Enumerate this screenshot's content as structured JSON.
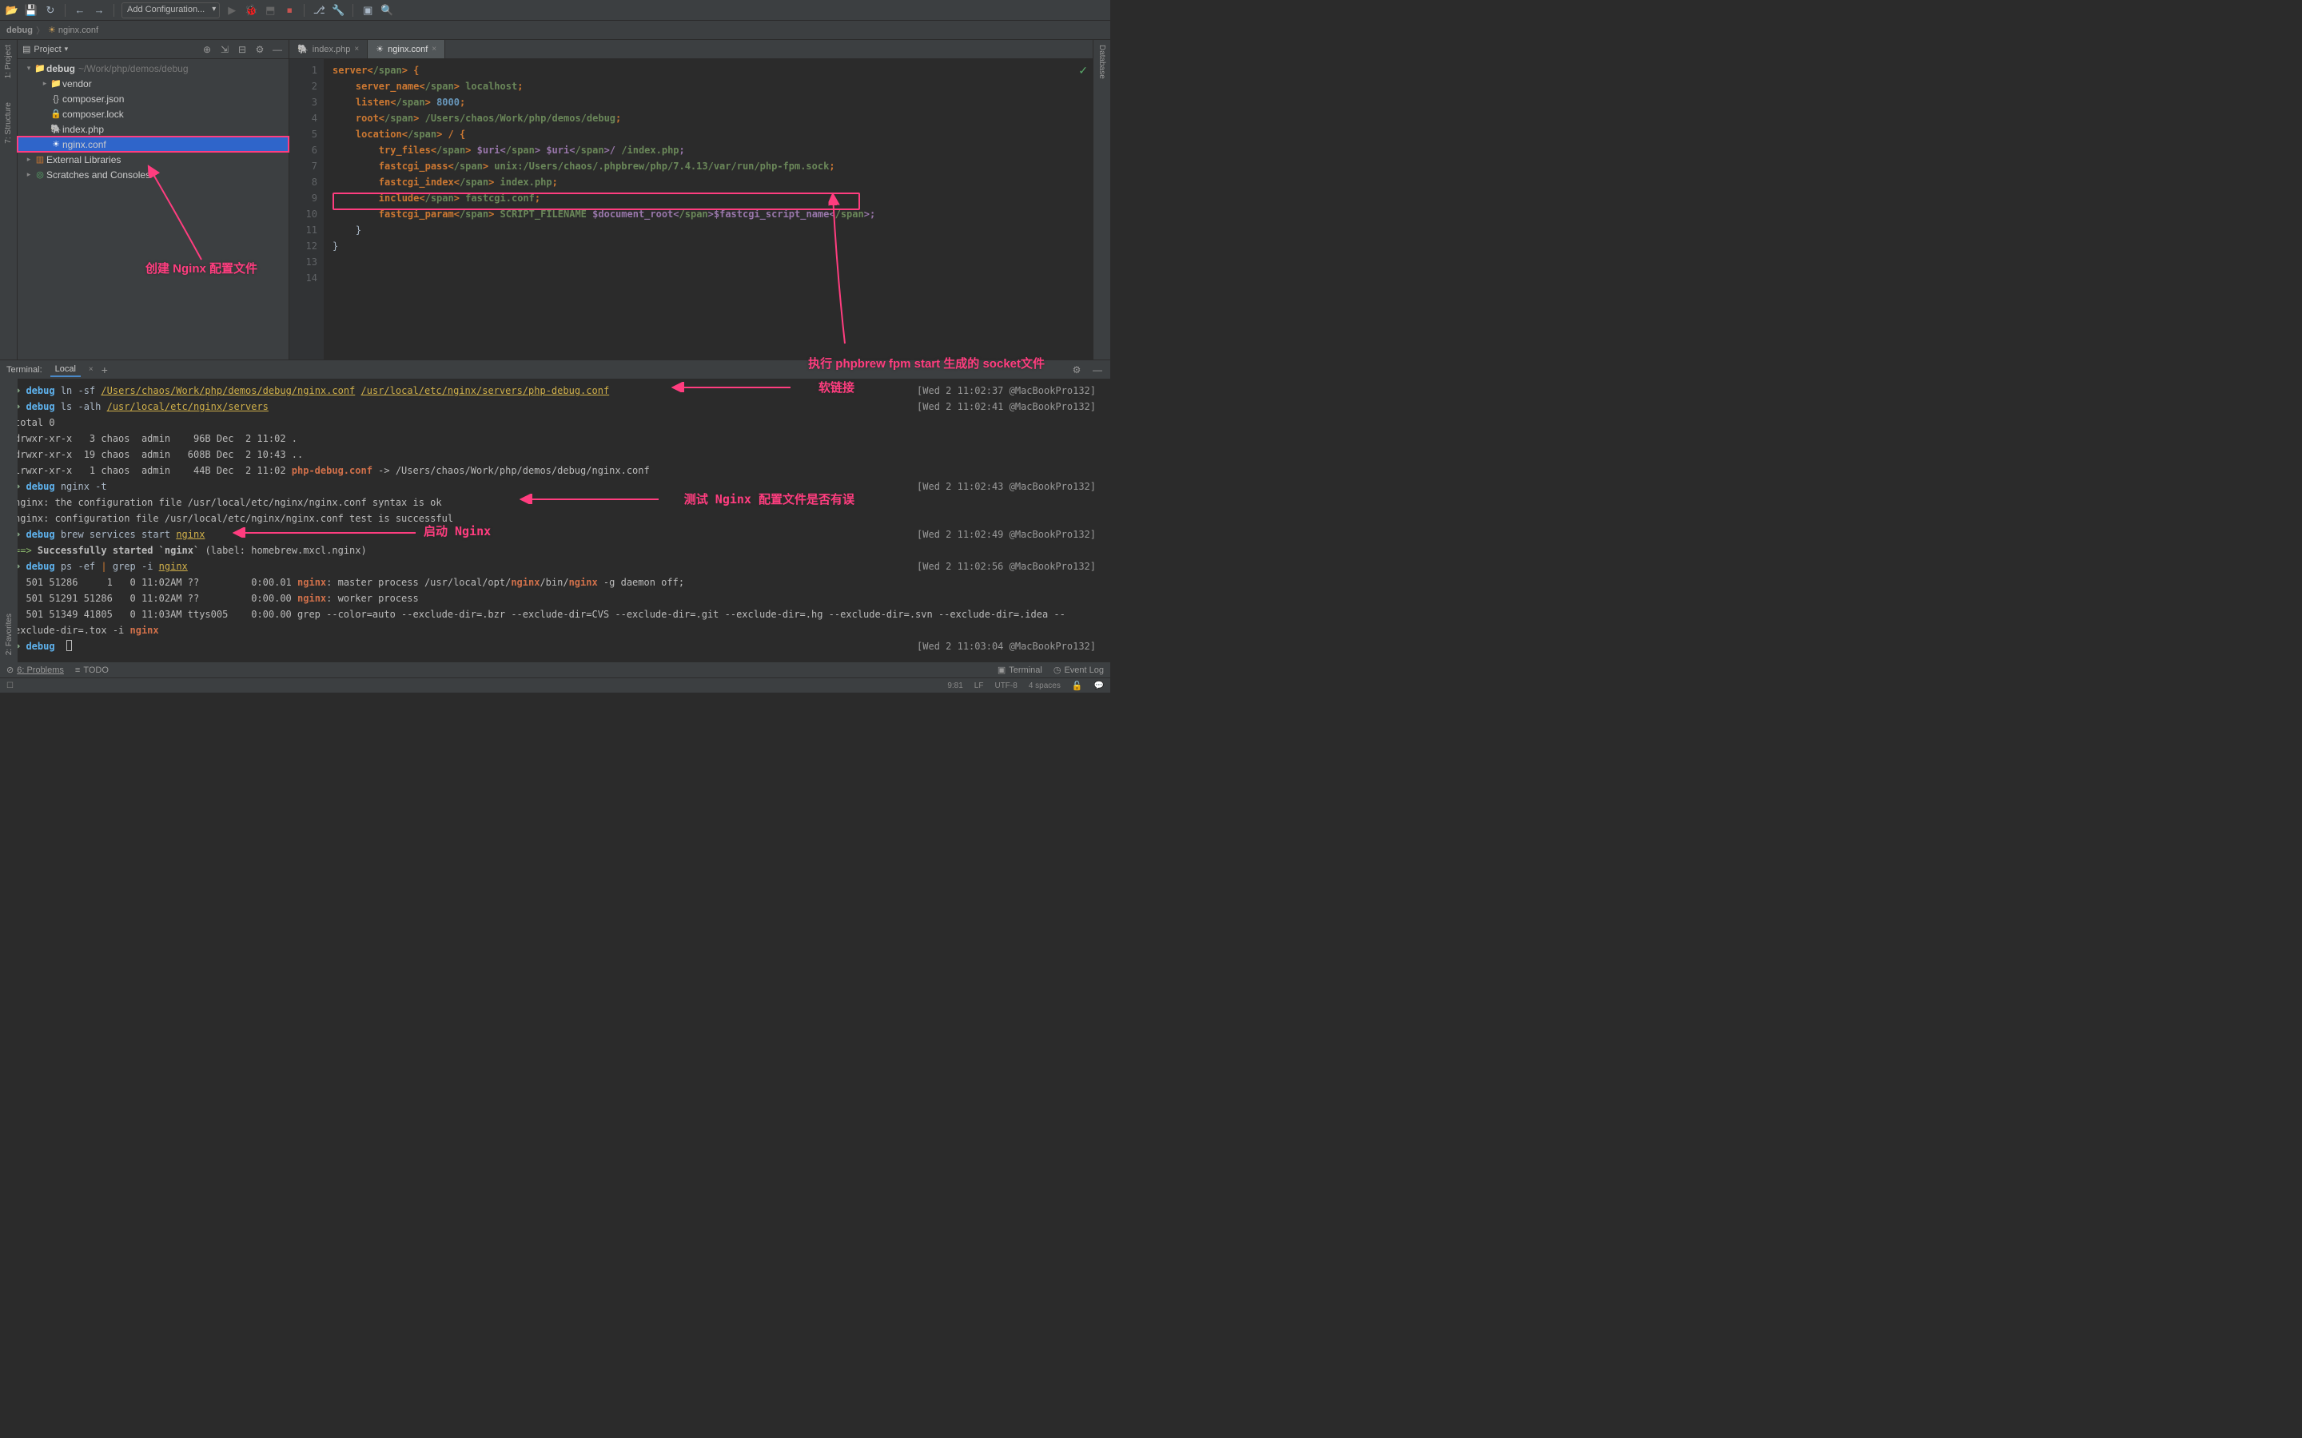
{
  "toolbar": {
    "config_label": "Add Configuration..."
  },
  "breadcrumb": {
    "root": "debug",
    "file": "nginx.conf"
  },
  "rails": {
    "project": "1: Project",
    "structure": "7: Structure",
    "favorites": "2: Favorites",
    "database": "Database"
  },
  "project": {
    "title": "Project",
    "root": "debug",
    "root_path": "~/Work/php/demos/debug",
    "items": [
      {
        "label": "vendor",
        "icon": "folder",
        "indent": 2,
        "arrow": "▸"
      },
      {
        "label": "composer.json",
        "icon": "json",
        "indent": 2
      },
      {
        "label": "composer.lock",
        "icon": "lock",
        "indent": 2
      },
      {
        "label": "index.php",
        "icon": "php",
        "indent": 2
      },
      {
        "label": "nginx.conf",
        "icon": "cog",
        "indent": 2,
        "selected": true
      }
    ],
    "external": "External Libraries",
    "scratches": "Scratches and Consoles"
  },
  "tabs": [
    {
      "label": "index.php",
      "icon": "php"
    },
    {
      "label": "nginx.conf",
      "icon": "cog",
      "active": true
    }
  ],
  "code": {
    "lines": [
      {
        "n": 1,
        "t": "server {",
        "kw": [
          "server"
        ]
      },
      {
        "n": 2,
        "t": "    server_name localhost;"
      },
      {
        "n": 3,
        "t": "    listen 8000;"
      },
      {
        "n": 4,
        "t": ""
      },
      {
        "n": 5,
        "t": "    root /Users/chaos/Work/php/demos/debug;"
      },
      {
        "n": 6,
        "t": ""
      },
      {
        "n": 7,
        "t": "    location / {"
      },
      {
        "n": 8,
        "t": "        try_files $uri $uri/ /index.php;"
      },
      {
        "n": 9,
        "t": "        fastcgi_pass unix:/Users/chaos/.phpbrew/php/7.4.13/var/run/php-fpm.sock;"
      },
      {
        "n": 10,
        "t": "        fastcgi_index index.php;"
      },
      {
        "n": 11,
        "t": "        include fastcgi.conf;"
      },
      {
        "n": 12,
        "t": "        fastcgi_param SCRIPT_FILENAME $document_root$fastcgi_script_name;"
      },
      {
        "n": 13,
        "t": "    }"
      },
      {
        "n": 14,
        "t": "}"
      }
    ]
  },
  "annotations": {
    "create_conf": "创建 Nginx 配置文件",
    "socket": "执行 phpbrew fpm start 生成的 socket文件",
    "symlink": "软链接",
    "test_conf": "测试 Nginx 配置文件是否有误",
    "start_nginx": "启动 Nginx"
  },
  "terminal": {
    "title": "Terminal:",
    "tab": "Local",
    "lines": [
      {
        "type": "cmd",
        "ctx": "debug",
        "cmd": "ln -sf ",
        "paths": [
          "/Users/chaos/Work/php/demos/debug/nginx.conf",
          "/usr/local/etc/nginx/servers/php-debug.conf"
        ],
        "time": "[Wed 2 11:02:37 @MacBookPro132]"
      },
      {
        "type": "cmd",
        "ctx": "debug",
        "cmd": "ls -alh ",
        "paths": [
          "/usr/local/etc/nginx/servers"
        ],
        "time": "[Wed 2 11:02:41 @MacBookPro132]"
      },
      {
        "type": "out",
        "text": "total 0"
      },
      {
        "type": "out",
        "text": "drwxr-xr-x   3 chaos  admin    96B Dec  2 11:02 ."
      },
      {
        "type": "out",
        "text": "drwxr-xr-x  19 chaos  admin   608B Dec  2 10:43 .."
      },
      {
        "type": "out",
        "text": "lrwxr-xr-x   1 chaos  admin    44B Dec  2 11:02 php-debug.conf -> /Users/chaos/Work/php/demos/debug/nginx.conf",
        "hl": "php-debug.conf"
      },
      {
        "type": "cmd",
        "ctx": "debug",
        "cmd": "nginx -t",
        "time": "[Wed 2 11:02:43 @MacBookPro132]"
      },
      {
        "type": "out",
        "text": "nginx: the configuration file /usr/local/etc/nginx/nginx.conf syntax is ok"
      },
      {
        "type": "out",
        "text": "nginx: configuration file /usr/local/etc/nginx/nginx.conf test is successful"
      },
      {
        "type": "cmd",
        "ctx": "debug",
        "cmd": "brew services start ",
        "paths": [
          "nginx"
        ],
        "time": "[Wed 2 11:02:49 @MacBookPro132]"
      },
      {
        "type": "ok",
        "text": "==> Successfully started `nginx` (label: homebrew.mxcl.nginx)"
      },
      {
        "type": "cmd",
        "ctx": "debug",
        "cmd": "ps -ef | grep -i ",
        "paths": [
          "nginx"
        ],
        "pipe": true,
        "time": "[Wed 2 11:02:56 @MacBookPro132]"
      },
      {
        "type": "out",
        "text": "  501 51286     1   0 11:02AM ??         0:00.01 nginx: master process /usr/local/opt/nginx/bin/nginx -g daemon off;",
        "hlwords": [
          "nginx",
          "nginx",
          "nginx"
        ]
      },
      {
        "type": "out",
        "text": "  501 51291 51286   0 11:02AM ??         0:00.00 nginx: worker process",
        "hlwords": [
          "nginx"
        ]
      },
      {
        "type": "out",
        "text": "  501 51349 41805   0 11:03AM ttys005    0:00.00 grep --color=auto --exclude-dir=.bzr --exclude-dir=CVS --exclude-dir=.git --exclude-dir=.hg --exclude-dir=.svn --exclude-dir=.idea --exclude-dir=.tox -i nginx",
        "hlwords": [
          "nginx"
        ],
        "wrap": true
      },
      {
        "type": "cmd",
        "ctx": "debug",
        "cmd": "",
        "cursor": true,
        "time": "[Wed 2 11:03:04 @MacBookPro132]"
      }
    ]
  },
  "bottombar": {
    "problems": "6: Problems",
    "todo": "TODO",
    "terminal": "Terminal",
    "eventlog": "Event Log"
  },
  "status": {
    "pos": "9:81",
    "le": "LF",
    "enc": "UTF-8",
    "indent": "4 spaces"
  }
}
